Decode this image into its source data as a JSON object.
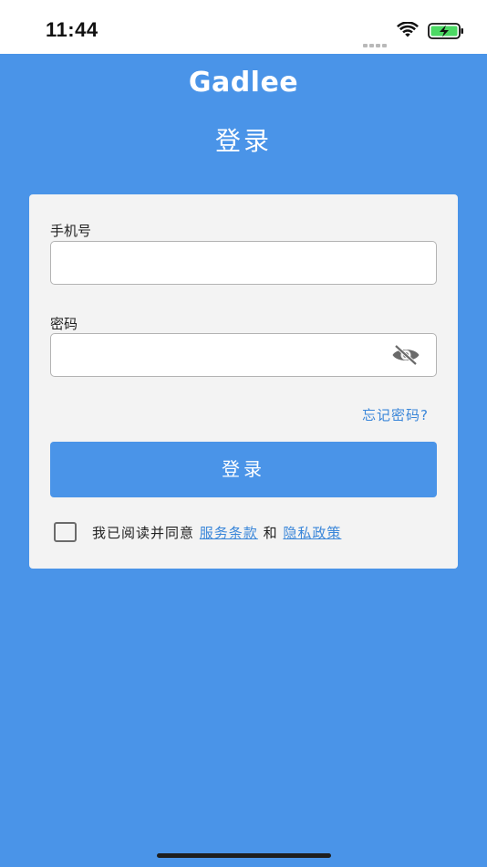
{
  "status_bar": {
    "time": "11:44",
    "battery_color": "#4cd964"
  },
  "brand": {
    "logo_text": "Gadlee",
    "background_color": "#4a94e8"
  },
  "page": {
    "title": "登录"
  },
  "form": {
    "phone_label": "手机号",
    "phone_value": "",
    "password_label": "密码",
    "password_value": "",
    "password_visibility_icon": "eye-off-icon",
    "forgot_password": "忘记密码?",
    "login_button": "登录"
  },
  "agreement": {
    "checked": false,
    "prefix": "我已阅读并同意",
    "terms_link": "服务条款",
    "conjunction": "和",
    "privacy_link": "隐私政策"
  }
}
